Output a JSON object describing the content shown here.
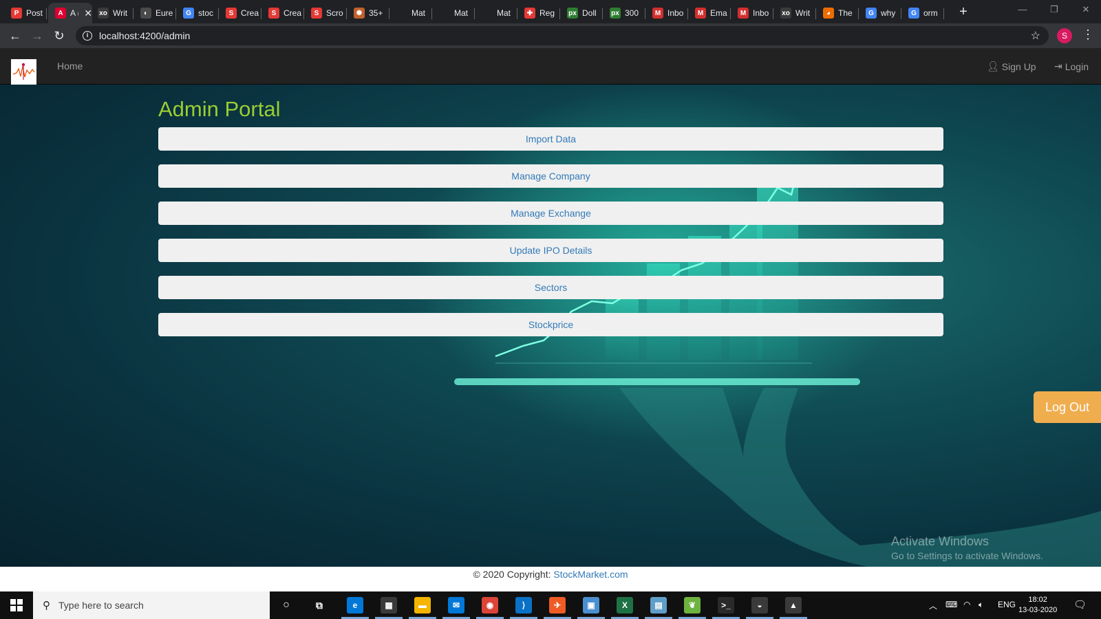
{
  "browser": {
    "tabs": [
      {
        "title": "Post",
        "favicon": "postman-icon",
        "color": "#e53935",
        "glyph": "P",
        "active": false
      },
      {
        "title": "A (",
        "favicon": "angular-icon",
        "color": "#dd0031",
        "glyph": "A",
        "active": true
      },
      {
        "title": "Writ",
        "favicon": "xo-icon",
        "color": "#3a3a3a",
        "glyph": "xo",
        "active": false
      },
      {
        "title": "Eure",
        "favicon": "globe-icon",
        "color": "#4a4a4a",
        "glyph": "◐",
        "active": false
      },
      {
        "title": "stoc",
        "favicon": "google-icon",
        "color": "#4285f4",
        "glyph": "G",
        "active": false
      },
      {
        "title": "Crea",
        "favicon": "s-icon",
        "color": "#e53935",
        "glyph": "S",
        "active": false
      },
      {
        "title": "Crea",
        "favicon": "s-icon",
        "color": "#e53935",
        "glyph": "S",
        "active": false
      },
      {
        "title": "Scro",
        "favicon": "s-icon",
        "color": "#e53935",
        "glyph": "S",
        "active": false
      },
      {
        "title": "35+",
        "favicon": "burst-icon",
        "color": "#c0622b",
        "glyph": "✺",
        "active": false
      },
      {
        "title": "Mat",
        "favicon": "blank-icon",
        "color": "#202124",
        "glyph": "",
        "active": false
      },
      {
        "title": "Mat",
        "favicon": "blank-icon",
        "color": "#202124",
        "glyph": "",
        "active": false
      },
      {
        "title": "Mat",
        "favicon": "blank-icon",
        "color": "#202124",
        "glyph": "",
        "active": false
      },
      {
        "title": "Reg",
        "favicon": "puzzle-icon",
        "color": "#e53935",
        "glyph": "✚",
        "active": false
      },
      {
        "title": "Doll",
        "favicon": "px-icon",
        "color": "#2e7d32",
        "glyph": "px",
        "active": false
      },
      {
        "title": "300",
        "favicon": "px-icon",
        "color": "#2e7d32",
        "glyph": "px",
        "active": false
      },
      {
        "title": "Inbo",
        "favicon": "gmail-icon",
        "color": "#d32f2f",
        "glyph": "M",
        "active": false
      },
      {
        "title": "Ema",
        "favicon": "gmail-icon",
        "color": "#d32f2f",
        "glyph": "M",
        "active": false
      },
      {
        "title": "Inbo",
        "favicon": "gmail-icon",
        "color": "#d32f2f",
        "glyph": "M",
        "active": false
      },
      {
        "title": "Writ",
        "favicon": "xo-icon",
        "color": "#3a3a3a",
        "glyph": "xo",
        "active": false
      },
      {
        "title": "The",
        "favicon": "flame-icon",
        "color": "#ef6c00",
        "glyph": "◕",
        "active": false
      },
      {
        "title": "why",
        "favicon": "google-icon",
        "color": "#4285f4",
        "glyph": "G",
        "active": false
      },
      {
        "title": "orm",
        "favicon": "google-icon",
        "color": "#4285f4",
        "glyph": "G",
        "active": false
      }
    ],
    "url": "localhost:4200/admin",
    "profile_initial": "S"
  },
  "app": {
    "nav": {
      "home": "Home",
      "signup": "Sign Up",
      "login": "Login"
    },
    "title": "Admin Portal",
    "menu": [
      "Import Data",
      "Manage Company",
      "Manage Exchange",
      "Update IPO Details",
      "Sectors",
      "Stockprice"
    ],
    "logout": "Log Out",
    "footer": {
      "text": "© 2020 Copyright: ",
      "link": "StockMarket.com"
    },
    "watermark": {
      "line1": "Activate Windows",
      "line2": "Go to Settings to activate Windows."
    }
  },
  "taskbar": {
    "search_placeholder": "Type here to search",
    "apps": [
      {
        "name": "edge-icon",
        "color": "#0078d7",
        "glyph": "e"
      },
      {
        "name": "store-icon",
        "color": "#3a3a3a",
        "glyph": "▦"
      },
      {
        "name": "file-explorer-icon",
        "color": "#f4b400",
        "glyph": "▬"
      },
      {
        "name": "mail-icon",
        "color": "#0078d7",
        "glyph": "✉"
      },
      {
        "name": "chrome-icon",
        "color": "#db4437",
        "glyph": "◉"
      },
      {
        "name": "vscode-icon",
        "color": "#0a72c6",
        "glyph": "⟩"
      },
      {
        "name": "postman-icon",
        "color": "#ef5b25",
        "glyph": "✈"
      },
      {
        "name": "remote-desktop-icon",
        "color": "#4a8fd0",
        "glyph": "▣"
      },
      {
        "name": "excel-icon",
        "color": "#1e7145",
        "glyph": "X"
      },
      {
        "name": "notepad-icon",
        "color": "#5f9ec9",
        "glyph": "▤"
      },
      {
        "name": "spring-icon",
        "color": "#6db33f",
        "glyph": "❦"
      },
      {
        "name": "terminal-icon",
        "color": "#2a2a2a",
        "glyph": ">_"
      },
      {
        "name": "mysql-workbench-icon",
        "color": "#3a3a3a",
        "glyph": "◒"
      },
      {
        "name": "photos-icon",
        "color": "#3a3a3a",
        "glyph": "▲"
      }
    ],
    "language": "ENG",
    "time": "18:02",
    "date": "13-03-2020"
  }
}
